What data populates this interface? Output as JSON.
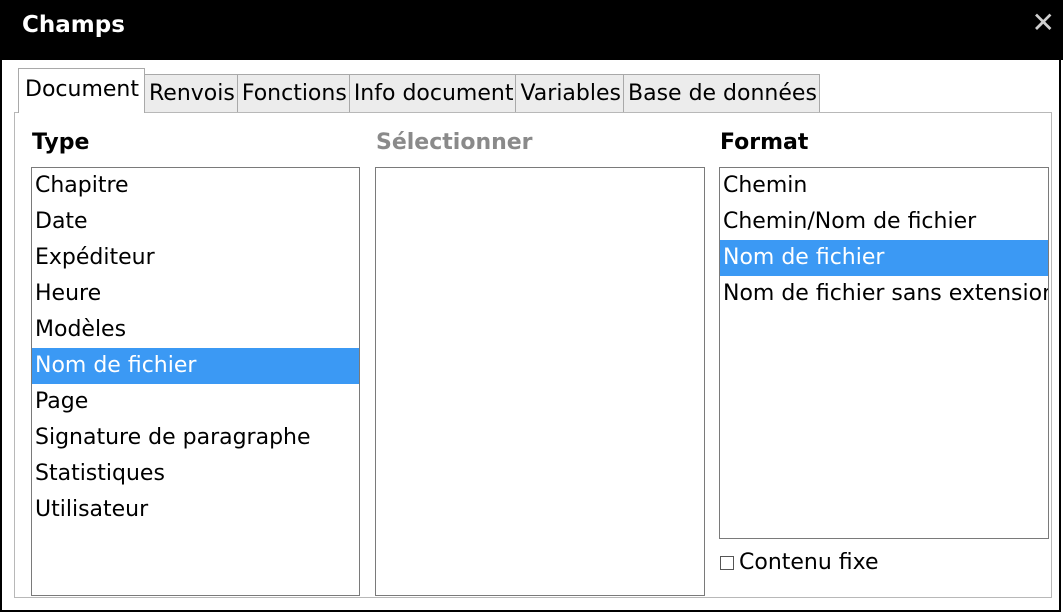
{
  "window": {
    "title": "Champs"
  },
  "tabs": [
    "Document",
    "Renvois",
    "Fonctions",
    "Info document",
    "Variables",
    "Base de données"
  ],
  "active_tab": "Document",
  "type_panel": {
    "label": "Type",
    "items": [
      "Chapitre",
      "Date",
      "Expéditeur",
      "Heure",
      "Modèles",
      "Nom de fichier",
      "Page",
      "Signature de paragraphe",
      "Statistiques",
      "Utilisateur"
    ],
    "selected": "Nom de fichier"
  },
  "select_panel": {
    "label": "Sélectionner",
    "items": []
  },
  "format_panel": {
    "label": "Format",
    "items": [
      "Chemin",
      "Chemin/Nom de fichier",
      "Nom de fichier",
      "Nom de fichier sans extension"
    ],
    "selected": "Nom de fichier"
  },
  "checkbox": {
    "label": "Contenu fixe",
    "checked": false
  },
  "colors": {
    "selection": "#3b99f4",
    "titlebar": "#000000"
  }
}
